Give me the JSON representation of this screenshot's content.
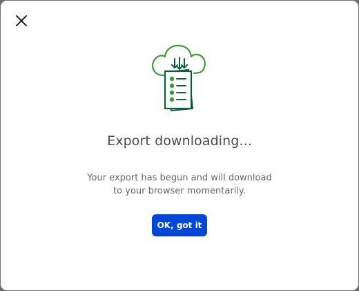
{
  "dialog": {
    "close_icon": "close-icon",
    "illustration_icon": "cloud-download-document-icon",
    "title": "Export downloading...",
    "message": "Your export has begun and will download to your browser momentarily.",
    "confirm_label": "OK, got it"
  },
  "colors": {
    "accent": "#0047d9",
    "illustration_green_light": "#3a9a3a",
    "illustration_green_dark": "#0f5c3a"
  }
}
